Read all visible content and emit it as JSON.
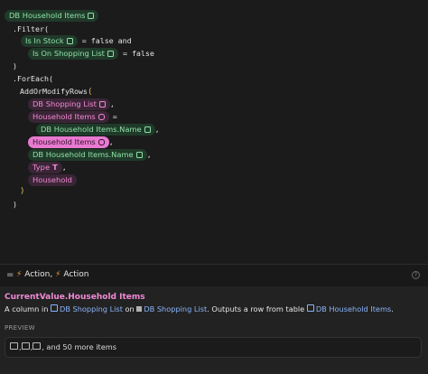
{
  "code": {
    "root_chip": "DB Household Items",
    "filter": ".Filter(",
    "filter_arg1_chip": "Is In Stock",
    "filter_arg1_rest": " = false and",
    "filter_arg2_chip": "Is On Shopping List",
    "filter_arg2_rest": " = false",
    "close_paren": ")",
    "foreach": ".ForEach(",
    "add_rows": "AddOrModifyRows",
    "open_bracket": "(",
    "chip_shopping_list": "DB Shopping List",
    "comma1": ",",
    "chip_household_items_col": "Household Items",
    "eq": "=",
    "chip_household_name1": "DB Household Items.Name",
    "comma2": ",",
    "chip_household_items_selected": "Household Items",
    "comma3": ",",
    "chip_household_name2": "DB Household Items.Name",
    "comma4": ",",
    "chip_type": "Type",
    "comma5": ",",
    "chip_household": "Household",
    "close_bracket": ")",
    "final_paren": ")"
  },
  "action_bar": {
    "eq_symbol": "=",
    "label_a": "Action",
    "sep": ", ",
    "label_b": "Action"
  },
  "info": {
    "title": "CurrentValue.Household Items",
    "desc_prefix": "A column in ",
    "desc_link1": "DB Shopping List",
    "desc_on": " on ",
    "desc_link2": "DB Shopping List",
    "desc_mid": ". Outputs a row from table ",
    "desc_link3": "DB Household Items",
    "desc_end": ".",
    "preview_label": "PREVIEW",
    "preview_text": ", and 50 more items"
  },
  "colors": {
    "green_chip_bg": "#203a2a",
    "green_chip_text": "#8ee0a6",
    "pink_chip_bg": "#3a2536",
    "pink_chip_text": "#f28ad5",
    "selected_chip_bg": "#e77ad0",
    "bracket": "#e4c15a",
    "link": "#8ab4f8",
    "bolt": "#f0a32f"
  }
}
